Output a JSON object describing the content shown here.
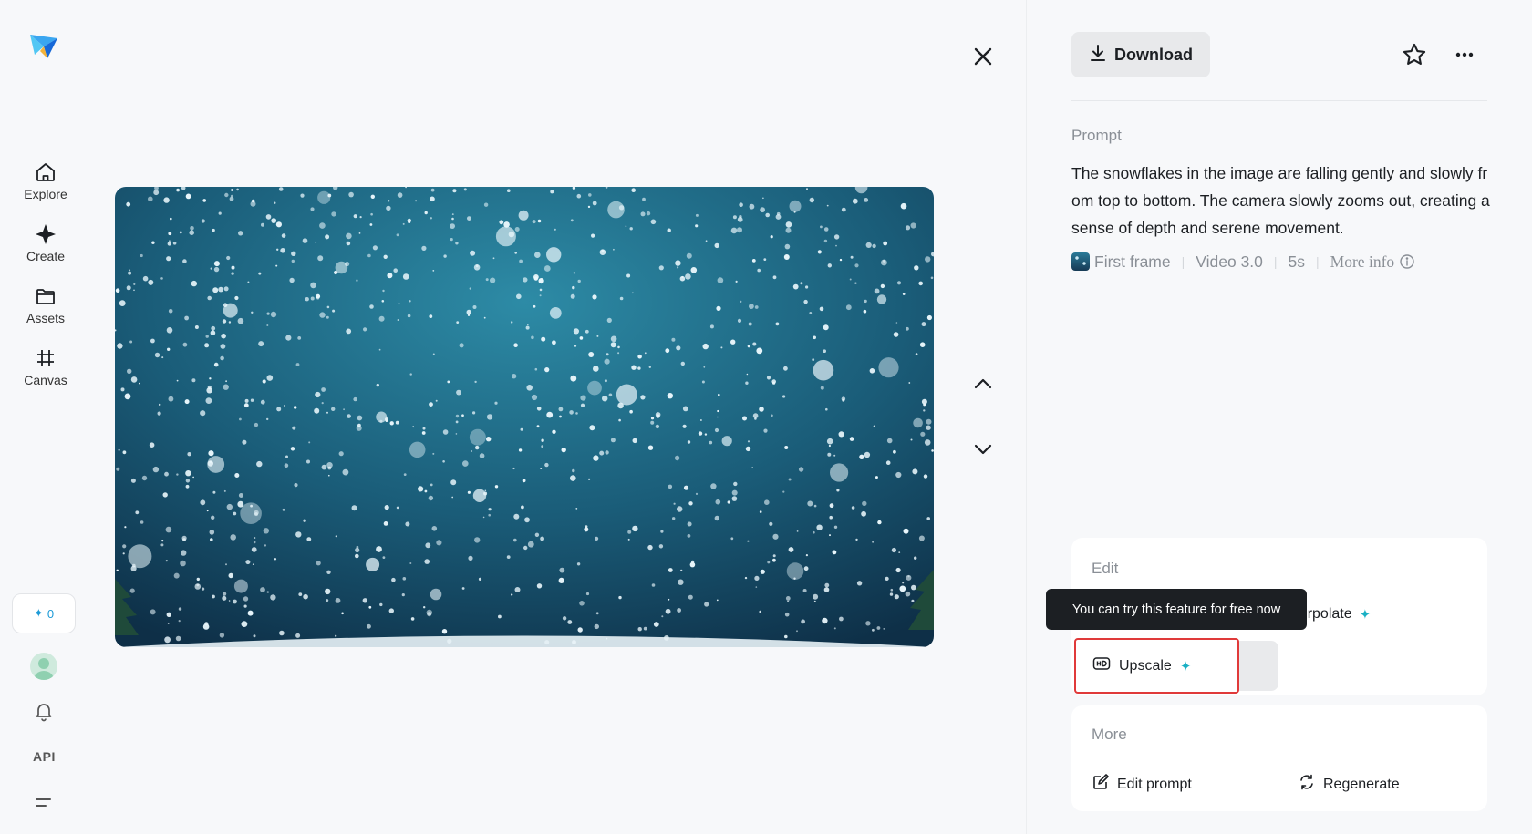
{
  "sidebar": {
    "items": [
      {
        "label": "Explore",
        "icon": "home-icon"
      },
      {
        "label": "Create",
        "icon": "sparkle-create-icon"
      },
      {
        "label": "Assets",
        "icon": "folder-icon"
      },
      {
        "label": "Canvas",
        "icon": "canvas-frame-icon"
      }
    ],
    "credits": "0",
    "api_label": "API"
  },
  "viewer": {
    "media_description_icon": "snowfall-video"
  },
  "panel": {
    "download_label": "Download",
    "prompt_label": "Prompt",
    "prompt_text": "The snowflakes in the image are falling gently and slowly from top to bottom. The camera slowly zooms out, creating a sense of depth and serene movement.",
    "meta": {
      "first_frame": "First frame",
      "model": "Video 3.0",
      "duration": "5s",
      "more_info": "More info"
    },
    "edit": {
      "title": "Edit",
      "interpolate": "Interpolate",
      "upscale": "Upscale",
      "tooltip": "You can try this feature for free now"
    },
    "more": {
      "title": "More",
      "edit_prompt": "Edit prompt",
      "regenerate": "Regenerate"
    }
  },
  "colors": {
    "accent": "#1ab0c4",
    "highlight_border": "#e03a3a",
    "tooltip_bg": "#1c1f23"
  }
}
